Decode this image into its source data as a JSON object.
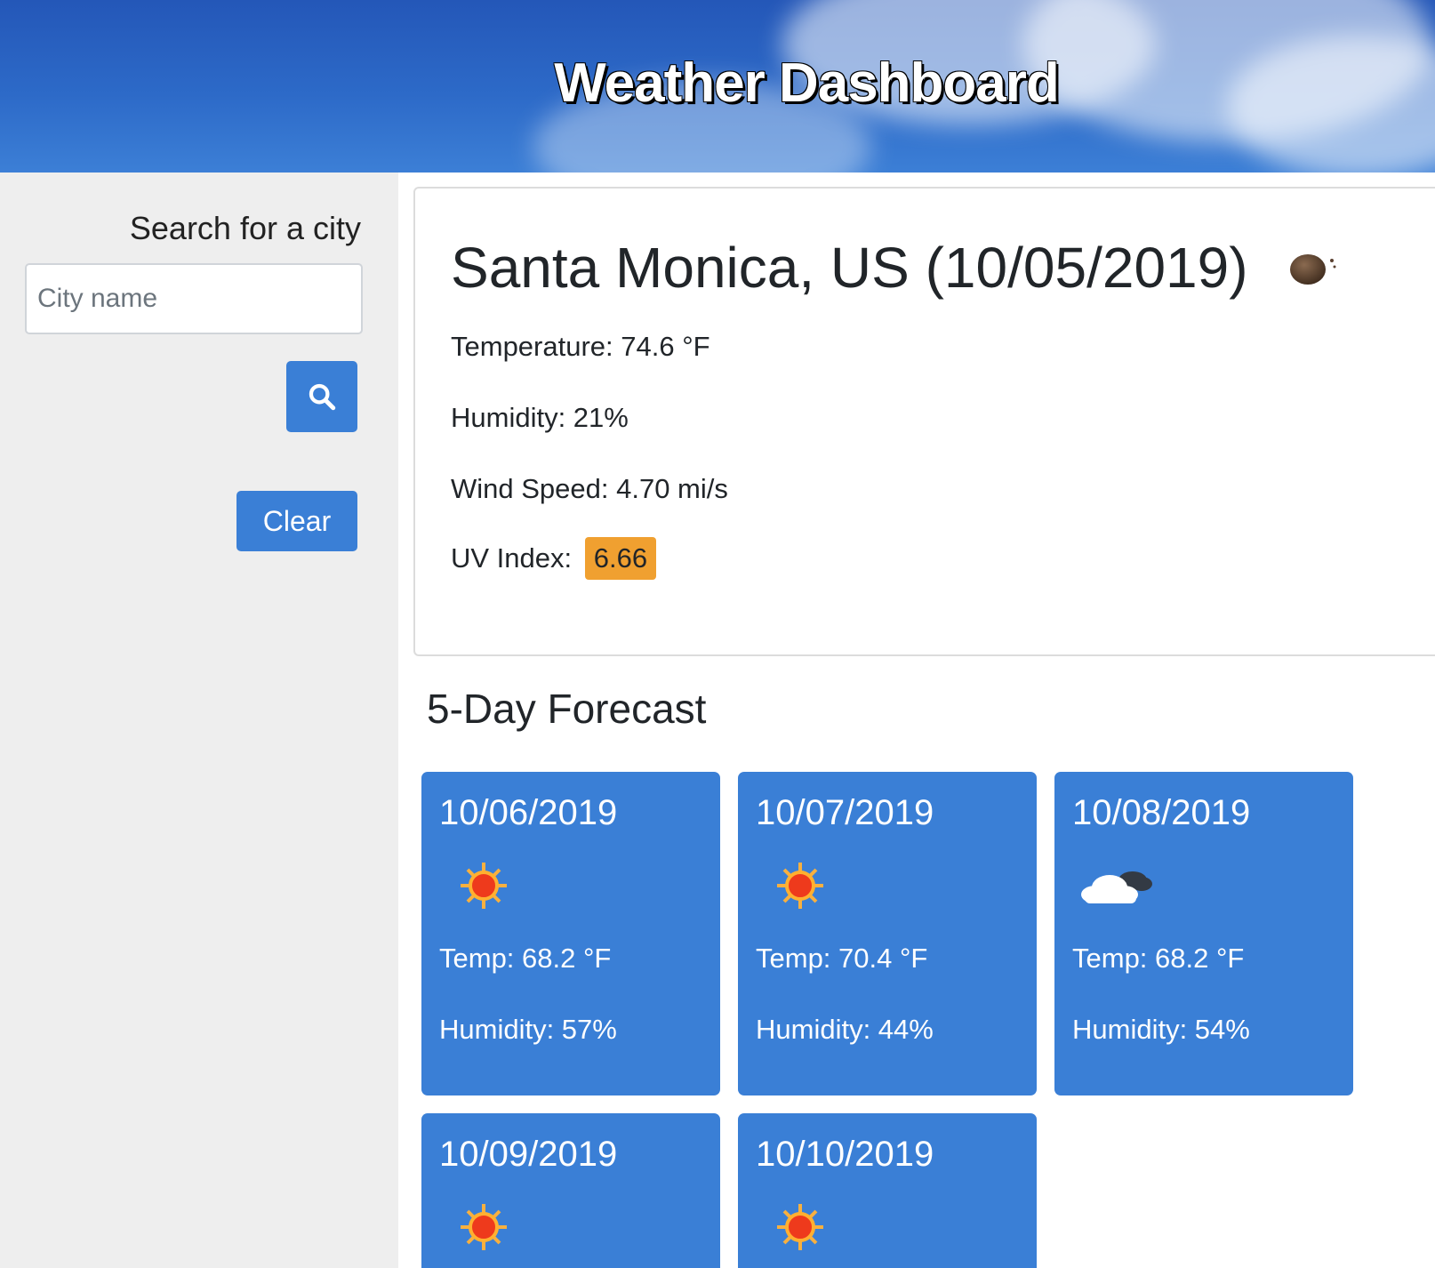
{
  "header": {
    "title": "Weather Dashboard"
  },
  "sidebar": {
    "search_label": "Search for a city",
    "city_input_placeholder": "City name",
    "city_input_value": "",
    "clear_label": "Clear"
  },
  "current": {
    "title": "Santa Monica, US (10/05/2019)",
    "icon": "clear-night-moon-icon",
    "temperature": "Temperature: 74.6 °F",
    "humidity": "Humidity: 21%",
    "wind": "Wind Speed: 4.70 mi/s",
    "uv_label": "UV Index:",
    "uv_value": "6.66",
    "uv_color": "#f0a030"
  },
  "forecast": {
    "title": "5-Day Forecast",
    "days": [
      {
        "date": "10/06/2019",
        "icon": "sun-icon",
        "temp": "Temp: 68.2 °F",
        "humidity": "Humidity: 57%"
      },
      {
        "date": "10/07/2019",
        "icon": "sun-icon",
        "temp": "Temp: 70.4 °F",
        "humidity": "Humidity: 44%"
      },
      {
        "date": "10/08/2019",
        "icon": "partly-cloudy-icon",
        "temp": "Temp: 68.2 °F",
        "humidity": "Humidity: 54%"
      },
      {
        "date": "10/09/2019",
        "icon": "sun-icon",
        "temp": "",
        "humidity": ""
      },
      {
        "date": "10/10/2019",
        "icon": "sun-icon",
        "temp": "",
        "humidity": ""
      }
    ]
  },
  "colors": {
    "accent": "#3a7fd6",
    "header": "#2d6ac8",
    "sidebar_bg": "#eeeeee"
  }
}
